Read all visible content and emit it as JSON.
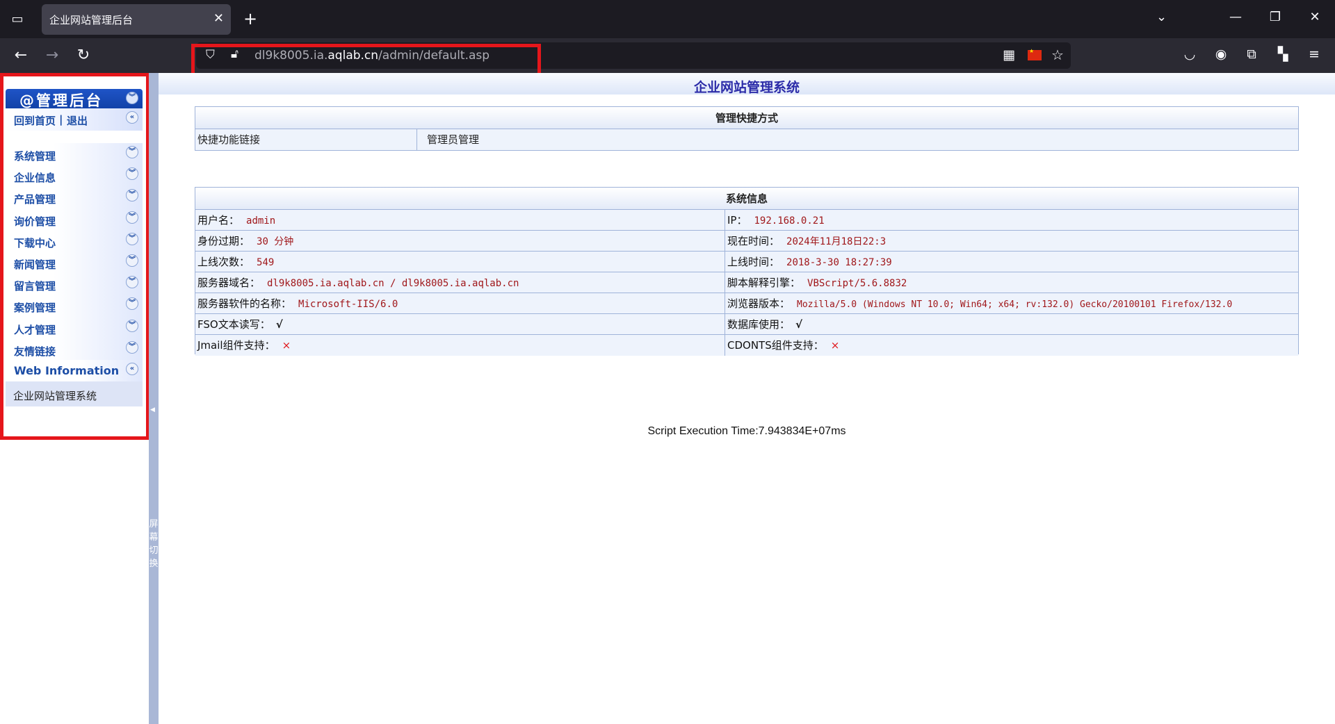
{
  "browser": {
    "tab_title": "企业网站管理后台",
    "url_prefix": "dl9k8005.ia.",
    "url_domain": "aqlab.cn",
    "url_path": "/admin/default.asp"
  },
  "sidebar": {
    "header": "@管理后台",
    "home": "回到首页",
    "separator": "|",
    "logout": "退出",
    "items": [
      {
        "label": "系统管理"
      },
      {
        "label": "企业信息"
      },
      {
        "label": "产品管理"
      },
      {
        "label": "询价管理"
      },
      {
        "label": "下载中心"
      },
      {
        "label": "新闻管理"
      },
      {
        "label": "留言管理"
      },
      {
        "label": "案例管理"
      },
      {
        "label": "人才管理"
      },
      {
        "label": "友情链接"
      }
    ],
    "web_info": "Web Information",
    "system_name": "企业网站管理系统",
    "split_text": "屏\n幕\n切\n换"
  },
  "main": {
    "title": "企业网站管理系统",
    "quick": {
      "header": "管理快捷方式",
      "label": "快捷功能链接",
      "link": "管理员管理"
    },
    "sysinfo": {
      "header": "系统信息",
      "rows": [
        {
          "l_label": "用户名：",
          "l_value": "admin",
          "r_label": "IP：",
          "r_value": "192.168.0.21"
        },
        {
          "l_label": "身份过期：",
          "l_value": "30 分钟",
          "r_label": "现在时间：",
          "r_value": "2024年11月18日22:3"
        },
        {
          "l_label": "上线次数：",
          "l_value": "549",
          "r_label": "上线时间：",
          "r_value": "2018-3-30 18:27:39"
        },
        {
          "l_label": "服务器域名：",
          "l_value": "dl9k8005.ia.aqlab.cn / dl9k8005.ia.aqlab.cn",
          "r_label": "脚本解释引擎：",
          "r_value": "VBScript/5.6.8832"
        },
        {
          "l_label": "服务器软件的名称：",
          "l_value": "Microsoft-IIS/6.0",
          "r_label": "浏览器版本：",
          "r_value": "Mozilla/5.0 (Windows NT 10.0; Win64; x64; rv:132.0) Gecko/20100101 Firefox/132.0"
        },
        {
          "l_label": "FSO文本读写：",
          "l_ok": "√",
          "r_label": "数据库使用：",
          "r_ok": "√"
        },
        {
          "l_label": "Jmail组件支持：",
          "l_x": "×",
          "r_label": "CDONTS组件支持：",
          "r_x": "×"
        }
      ]
    },
    "exec_time": "Script Execution Time:7.943834E+07ms"
  },
  "colors": {
    "highlight_box": "#e5161b",
    "menu_blue": "#1d4ea6",
    "title_color": "#2b2ba8",
    "value_red": "#a0171a"
  }
}
